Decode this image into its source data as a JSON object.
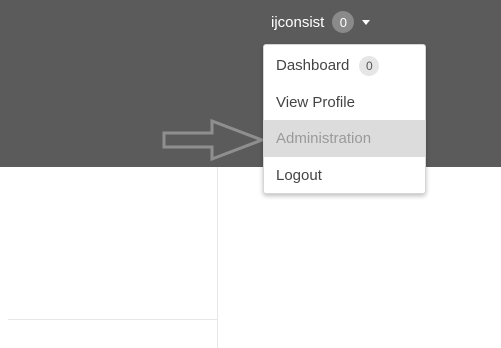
{
  "user_menu": {
    "username": "ijconsist",
    "badge_count": "0",
    "caret_icon": "chevron-down-icon"
  },
  "dropdown": {
    "items": [
      {
        "label": "Dashboard",
        "badge": "0"
      },
      {
        "label": "View Profile"
      },
      {
        "label": "Administration",
        "state": "hovered"
      },
      {
        "label": "Logout"
      }
    ]
  },
  "annotation": {
    "icon": "right-arrow-outline-icon",
    "color": "#8f8f8f"
  },
  "colors": {
    "topbar": "#5b5b5b",
    "dropdown_bg": "#ffffff",
    "hover_bg": "#dcdcdc"
  }
}
